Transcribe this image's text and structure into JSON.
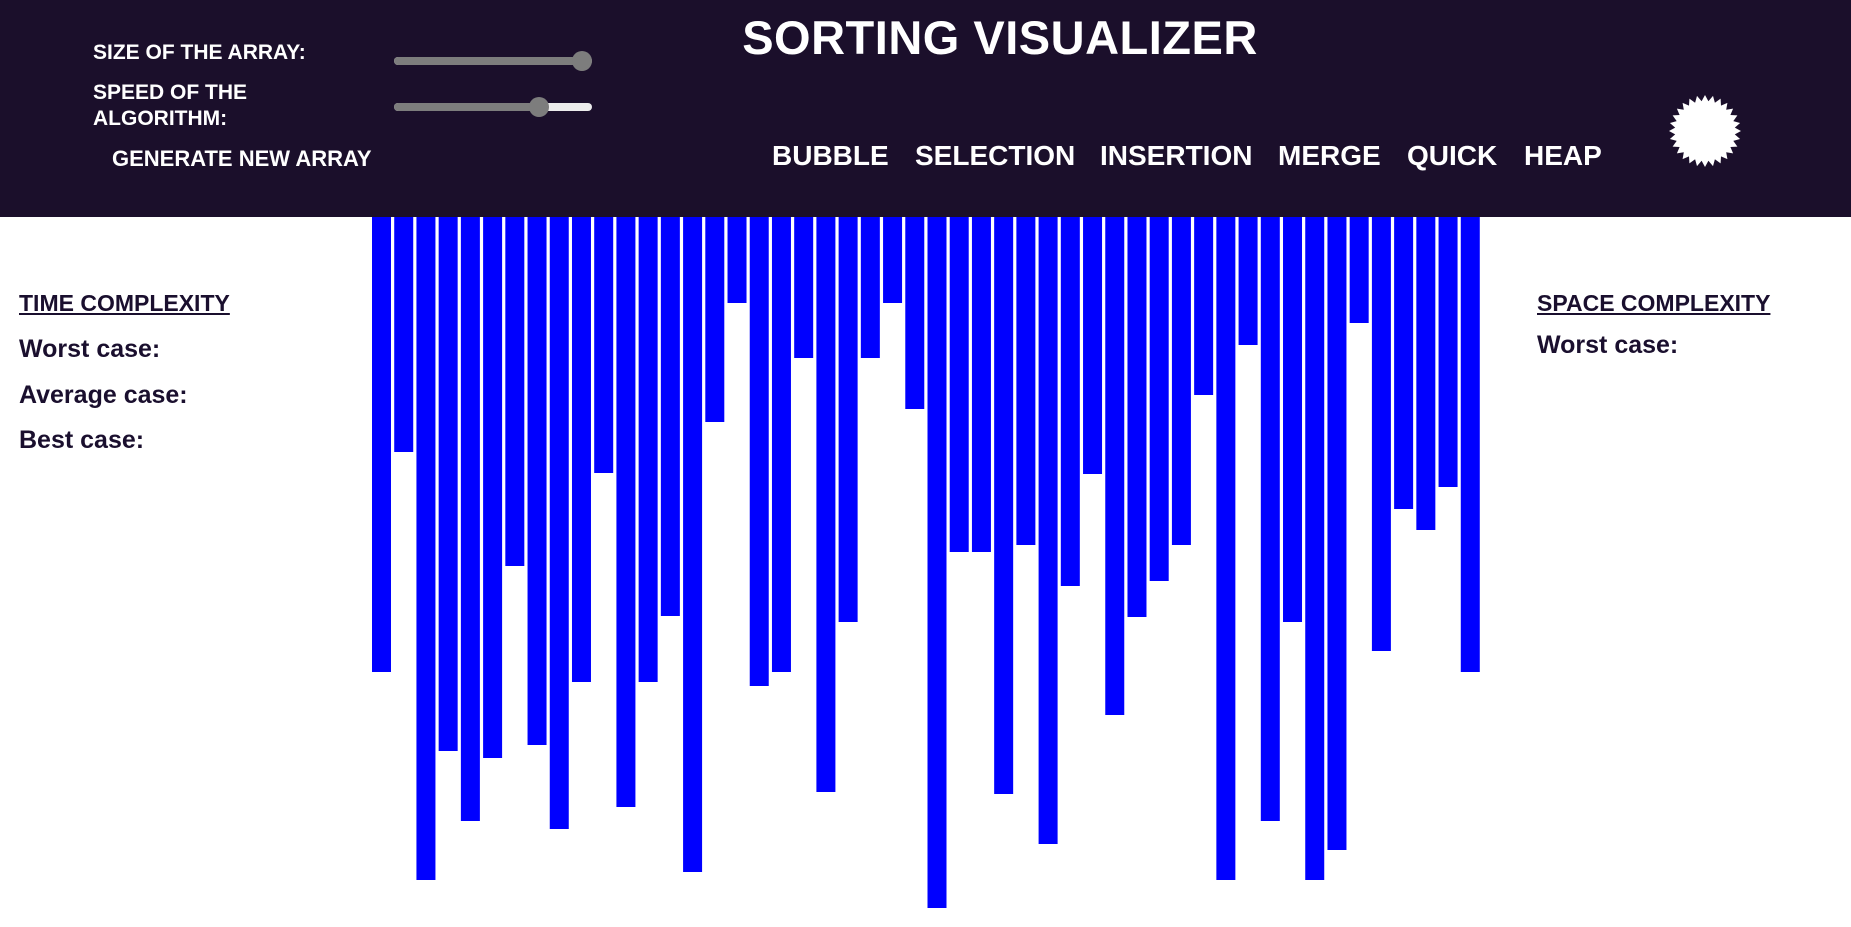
{
  "header": {
    "title": "SORTING VISUALIZER",
    "size_label": "SIZE OF THE ARRAY:",
    "speed_label": "SPEED OF THE ALGORITHM:",
    "generate_label": "GENERATE NEW ARRAY",
    "size_slider_value": 0.95,
    "speed_slider_value": 0.73,
    "algorithms": [
      "BUBBLE",
      "SELECTION",
      "INSERTION",
      "MERGE",
      "QUICK",
      "HEAP"
    ],
    "theme_icon": "sun-burst-icon"
  },
  "time_complexity": {
    "title": "TIME COMPLEXITY",
    "worst_label": "Worst case:",
    "average_label": "Average case:",
    "best_label": "Best case:"
  },
  "space_complexity": {
    "title": "SPACE COMPLEXITY",
    "worst_label": "Worst case:"
  },
  "colors": {
    "header_bg": "#1b0f2b",
    "bar": "#0000ff",
    "text": "#1a0f2e"
  },
  "chart_data": {
    "type": "bar",
    "values": [
      455,
      235,
      663,
      534,
      604,
      541,
      349,
      528,
      612,
      465,
      256,
      590,
      465,
      399,
      655,
      205,
      86,
      469,
      455,
      141,
      575,
      405,
      141,
      86,
      192,
      691,
      335,
      335,
      577,
      328,
      627,
      369,
      257,
      498,
      400,
      364,
      328,
      178,
      663,
      128,
      604,
      405,
      663,
      633,
      106,
      434,
      292,
      313,
      270,
      455
    ]
  }
}
